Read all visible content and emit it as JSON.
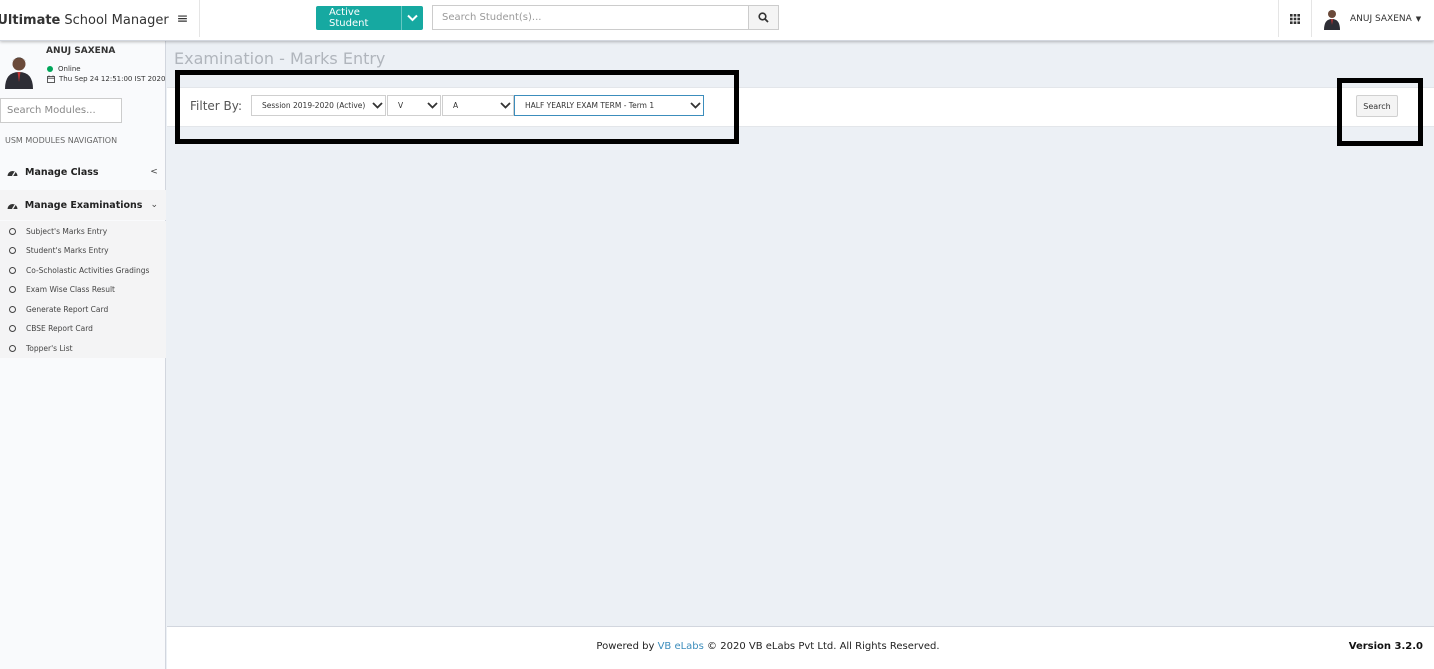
{
  "app": {
    "logo_bold": "Ultimate",
    "logo_rest": "School Manager"
  },
  "header": {
    "active_student_label": "Active Student",
    "search_placeholder": "Search Student(s)...",
    "user_name": "ANUJ SAXENA"
  },
  "sidebar": {
    "user_name": "ANUJ SAXENA",
    "status": "Online",
    "datetime": "Thu Sep 24 12:51:00 IST 2020",
    "search_placeholder": "Search Modules...",
    "nav_header": "USM MODULES NAVIGATION",
    "nav": [
      {
        "label": "Manage Class",
        "chevron": "<"
      },
      {
        "label": "Manage Examinations",
        "chevron": "⌄"
      }
    ],
    "submenu": [
      {
        "label": "Subject's Marks Entry"
      },
      {
        "label": "Student's Marks Entry"
      },
      {
        "label": "Co-Scholastic Activities Gradings"
      },
      {
        "label": "Exam Wise Class Result"
      },
      {
        "label": "Generate Report Card"
      },
      {
        "label": "CBSE Report Card"
      },
      {
        "label": "Topper's List"
      }
    ]
  },
  "main": {
    "page_title": "Examination - Marks Entry",
    "filter_label": "Filter By:",
    "filters": {
      "session": "Session 2019-2020 (Active)",
      "class": "V",
      "section": "A",
      "exam": "HALF YEARLY EXAM TERM - Term 1"
    },
    "search_button": "Search"
  },
  "footer": {
    "powered_by": "Powered by",
    "company_link": "VB eLabs",
    "copyright": "© 2020 VB eLabs Pvt Ltd. All Rights Reserved.",
    "version": "Version 3.2.0"
  },
  "colors": {
    "accent": "#16a9a1",
    "link": "#3c8dbc",
    "online": "#00a65a",
    "content_bg": "#ecf0f5"
  }
}
